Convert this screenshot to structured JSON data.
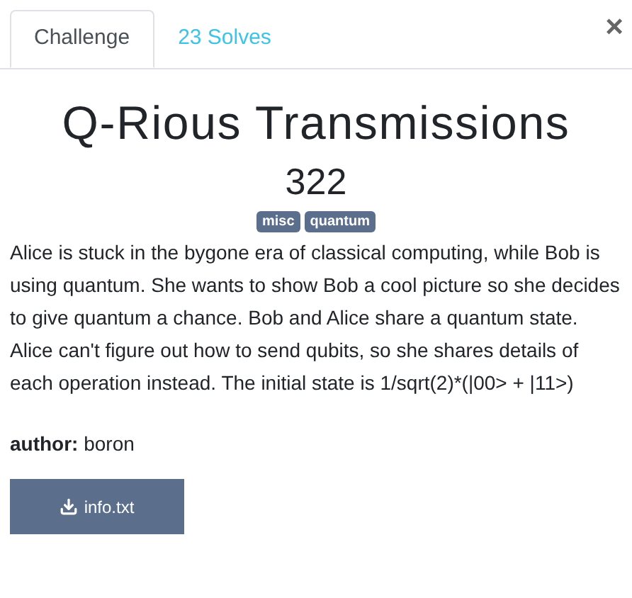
{
  "tabs": [
    {
      "label": "Challenge",
      "selected": true
    },
    {
      "label": "23 Solves",
      "selected": false
    }
  ],
  "close": "×",
  "challenge": {
    "name": "Q-Rious Transmissions",
    "value": "322",
    "tags": [
      "misc",
      "quantum"
    ],
    "description": "Alice is stuck in the bygone era of classical computing, while Bob is using quantum. She wants to show Bob a cool picture so she decides to give quantum a chance. Bob and Alice share a quantum state. Alice can't figure out how to send qubits, so she shares details of each operation instead. The initial state is 1/sqrt(2)*(|00> + |11>)",
    "author": "**author:** boron",
    "files": [
      "info.txt"
    ]
  }
}
